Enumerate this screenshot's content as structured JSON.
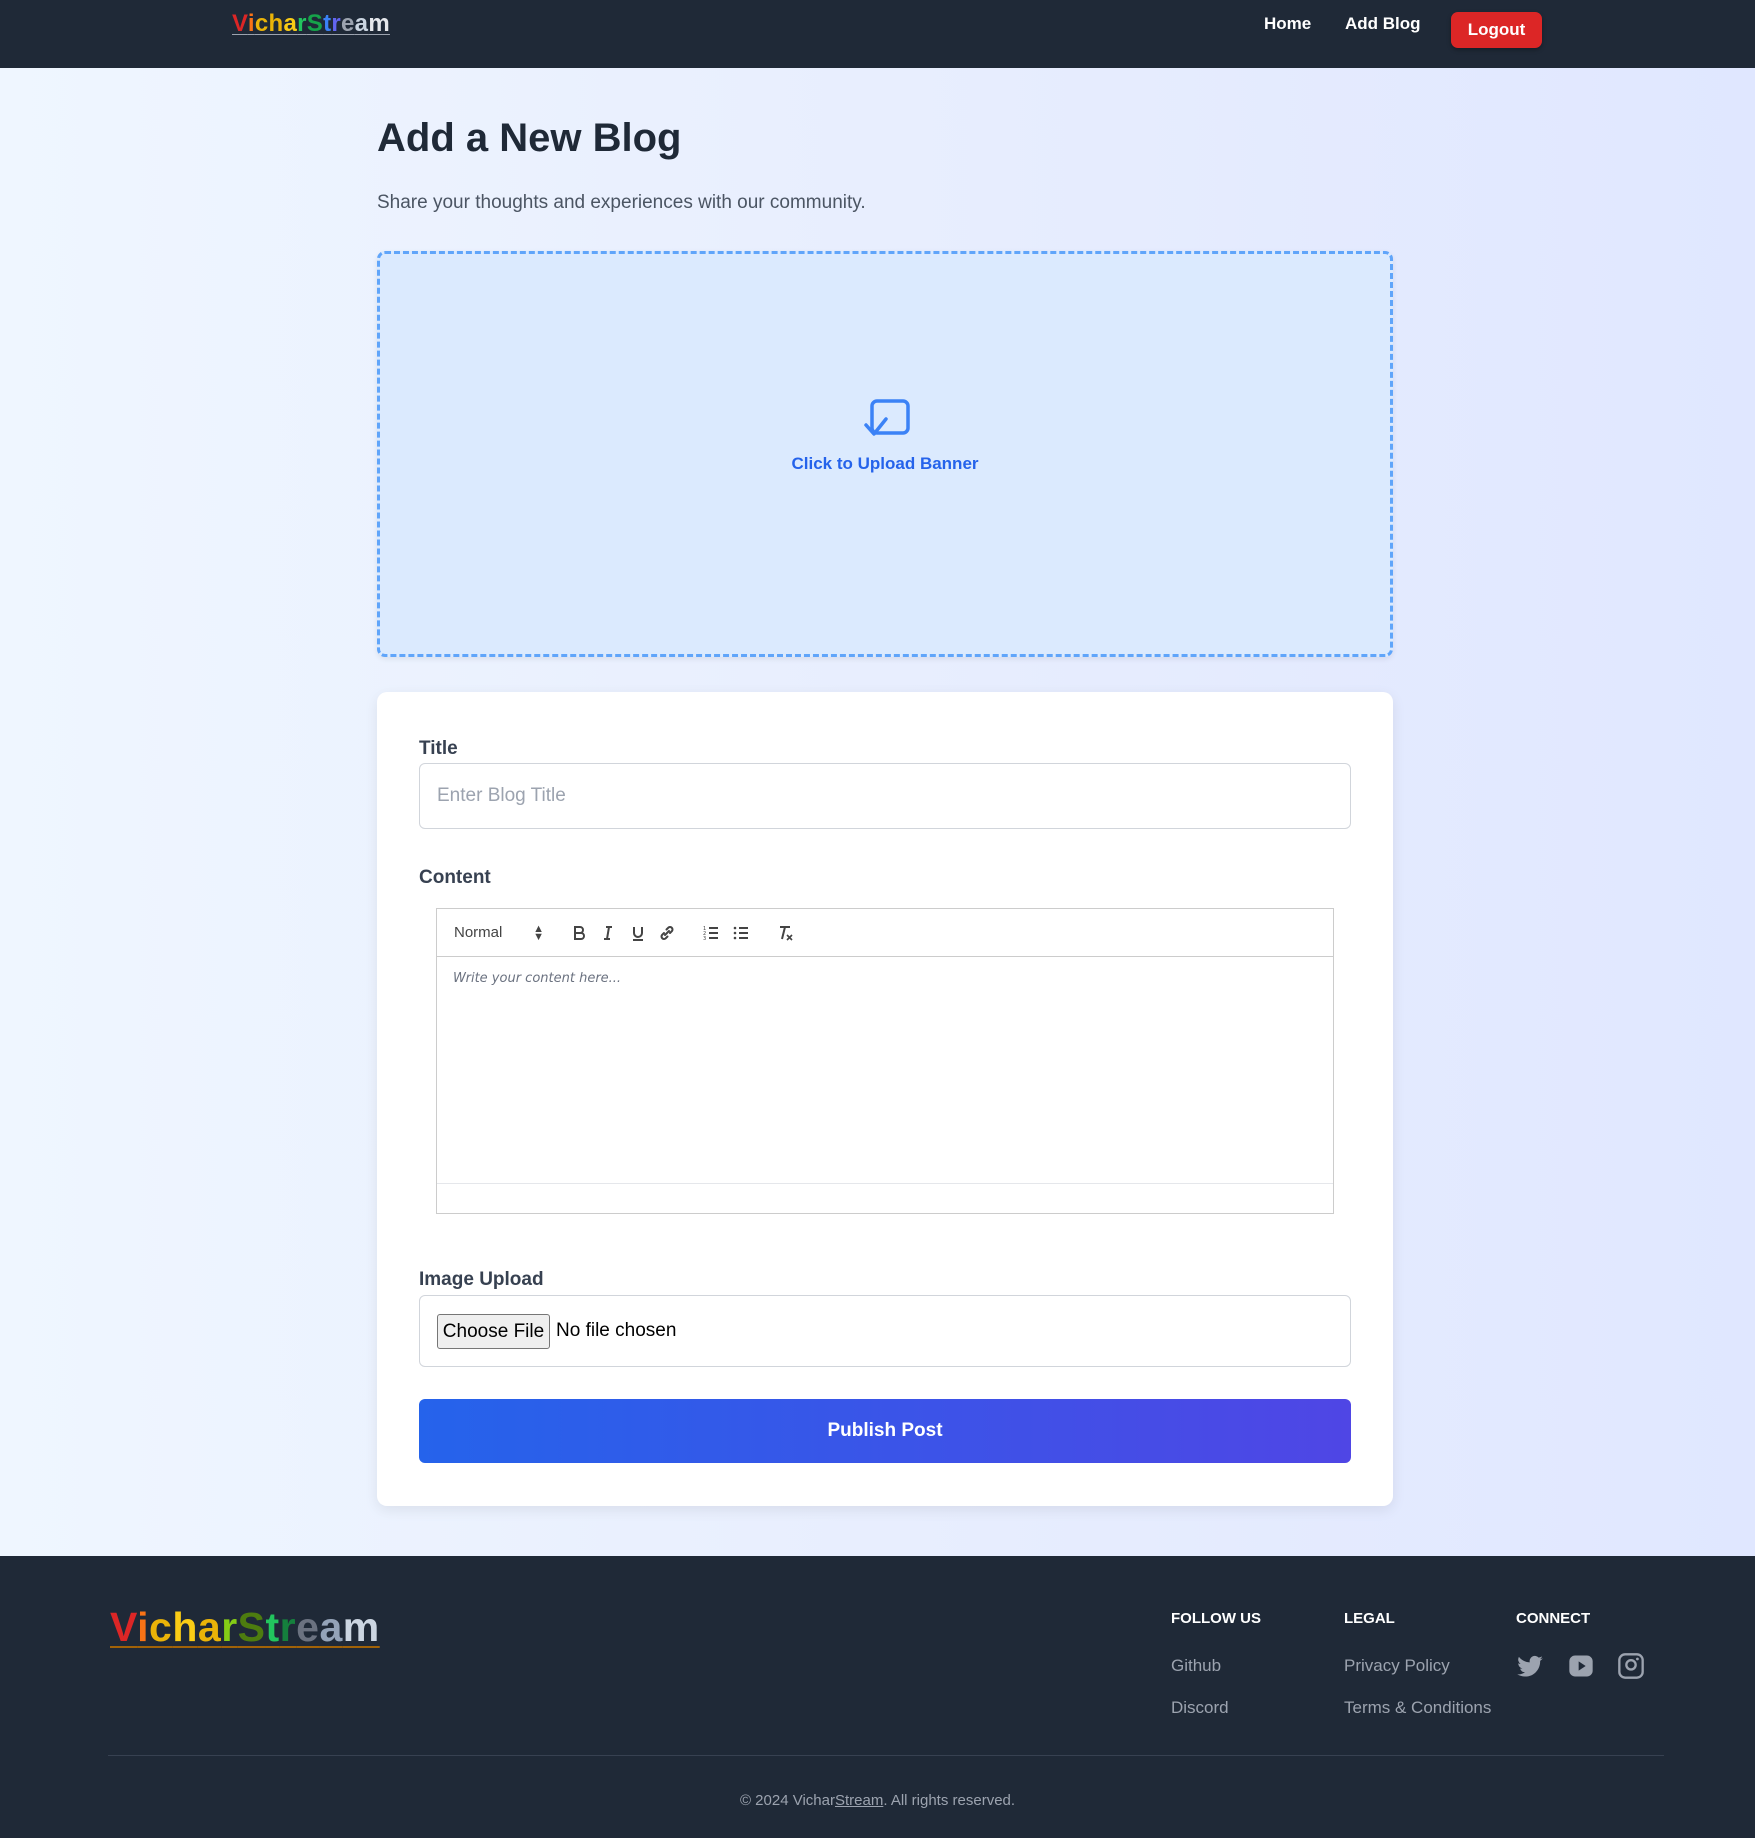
{
  "nav": {
    "logo_parts": [
      {
        "text": "V",
        "color": "#dc2626"
      },
      {
        "text": "i",
        "color": "#f97316"
      },
      {
        "text": "c",
        "color": "#eab308"
      },
      {
        "text": "h",
        "color": "#eab308"
      },
      {
        "text": "a",
        "color": "#facc15"
      },
      {
        "text": "r",
        "color": "#22c55e"
      },
      {
        "text": "S",
        "color": "#16a34a"
      },
      {
        "text": "t",
        "color": "#3b82f6"
      },
      {
        "text": "r",
        "color": "#6366f1"
      },
      {
        "text": "e",
        "color": "#9ca3af"
      },
      {
        "text": "a",
        "color": "#cbd5e1"
      },
      {
        "text": "m",
        "color": "#e5e7eb"
      }
    ],
    "links": [
      "Home",
      "Add Blog"
    ],
    "logout_label": "Logout"
  },
  "header": {
    "title": "Add a New Blog",
    "subtitle": "Share your thoughts and experiences with our community."
  },
  "banner": {
    "icon": "upload-image-icon",
    "text": "Click to Upload Banner"
  },
  "form": {
    "title_label": "Title",
    "title_placeholder": "Enter Blog Title",
    "title_value": "",
    "content_label": "Content",
    "toolbar": {
      "format_selected": "Normal",
      "buttons": [
        "bold-icon",
        "italic-icon",
        "underline-icon",
        "link-icon",
        "ordered-list-icon",
        "bullet-list-icon",
        "clear-format-icon"
      ]
    },
    "content_placeholder": "Write your content here...",
    "image_label": "Image Upload",
    "choose_file_label": "Choose File",
    "file_status": "No file chosen",
    "publish_label": "Publish Post"
  },
  "footer": {
    "logo_parts": [
      {
        "text": "V",
        "color": "#dc2626"
      },
      {
        "text": "i",
        "color": "#f97316"
      },
      {
        "text": "c",
        "color": "#eab308"
      },
      {
        "text": "h",
        "color": "#facc15"
      },
      {
        "text": "a",
        "color": "#eab308"
      },
      {
        "text": "r",
        "color": "#84cc16"
      },
      {
        "text": "S",
        "color": "#4d7c0f"
      },
      {
        "text": "t",
        "color": "#22c55e"
      },
      {
        "text": "r",
        "color": "#15803d"
      },
      {
        "text": "e",
        "color": "#6b7280"
      },
      {
        "text": "a",
        "color": "#94a3b8"
      },
      {
        "text": "m",
        "color": "#cbd5e1"
      }
    ],
    "columns": [
      {
        "heading": "FOLLOW US",
        "links": [
          "Github",
          "Discord"
        ]
      },
      {
        "heading": "LEGAL",
        "links": [
          "Privacy Policy",
          "Terms & Conditions"
        ]
      },
      {
        "heading": "CONNECT",
        "icons": [
          "twitter-icon",
          "youtube-icon",
          "instagram-icon"
        ]
      }
    ],
    "copyright_prefix": "© 2024 Vichar",
    "copyright_brand": "Stream",
    "copyright_suffix": ". All rights reserved."
  },
  "colors": {
    "navbar": "#1f2937",
    "logout": "#dc2626",
    "accent": "#2563eb",
    "publish_gradient": [
      "#2563eb",
      "#4f46e5"
    ]
  }
}
